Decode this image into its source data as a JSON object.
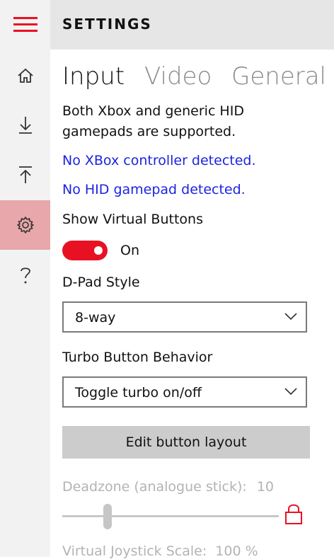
{
  "header": {
    "title": "SETTINGS"
  },
  "nav": {
    "items": [
      {
        "icon": "home-icon"
      },
      {
        "icon": "download-icon"
      },
      {
        "icon": "upload-icon"
      },
      {
        "icon": "gear-icon",
        "active": true
      },
      {
        "icon": "help-icon"
      }
    ]
  },
  "tabs": [
    {
      "label": "Input",
      "active": true
    },
    {
      "label": "Video"
    },
    {
      "label": "General"
    }
  ],
  "content": {
    "support_line1": "Both Xbox and generic HID",
    "support_line2": "gamepads are supported.",
    "xbox_status": "No XBox controller detected.",
    "hid_status": "No HID gamepad detected.",
    "show_virtual_label": "Show Virtual Buttons",
    "show_virtual_state": "On",
    "dpad_label": "D-Pad Style",
    "dpad_value": "8-way",
    "turbo_label": "Turbo Button Behavior",
    "turbo_value": "Toggle turbo on/off",
    "edit_button": "Edit button layout",
    "deadzone_label": "Deadzone (analogue stick):",
    "deadzone_value": "10",
    "joystick_scale_label": "Virtual Joystick Scale:",
    "joystick_scale_value": "100 %"
  },
  "colors": {
    "accent": "#e81123",
    "link": "#1c24e0",
    "active_nav_bg": "#e8a7aa"
  }
}
